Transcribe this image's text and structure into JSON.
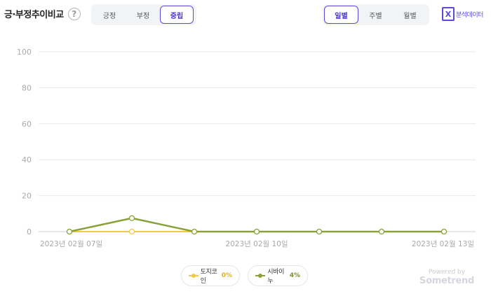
{
  "header": {
    "title": "긍·부정추이비교",
    "help_glyph": "?",
    "sentiment_tabs": [
      "긍정",
      "부정",
      "중립"
    ],
    "sentiment_active": "중립",
    "period_tabs": [
      "일별",
      "주별",
      "월별"
    ],
    "period_active": "일별",
    "export_label": "분석데이터",
    "export_icon": "excel-icon"
  },
  "chart_data": {
    "type": "line",
    "x": [
      "2023-02-07",
      "2023-02-08",
      "2023-02-09",
      "2023-02-10",
      "2023-02-11",
      "2023-02-12",
      "2023-02-13"
    ],
    "x_tick_labels": [
      "2023년 02월 07일",
      "2023년 02월 10일",
      "2023년 02월 13일"
    ],
    "y_ticks": [
      0,
      20,
      40,
      60,
      80,
      100
    ],
    "ylim": [
      0,
      100
    ],
    "grid": true,
    "legend_position": "bottom",
    "series": [
      {
        "name": "도지코인",
        "percent": "0%",
        "color": "#f2c94c",
        "values": [
          0,
          0,
          0,
          0,
          0,
          0,
          0
        ]
      },
      {
        "name": "시바이누",
        "percent": "4%",
        "color": "#8aa13a",
        "values": [
          0,
          7.5,
          0,
          0,
          0,
          0,
          0
        ]
      }
    ]
  },
  "footer": {
    "powered_by": "Powered by",
    "brand": "Sometrend"
  }
}
